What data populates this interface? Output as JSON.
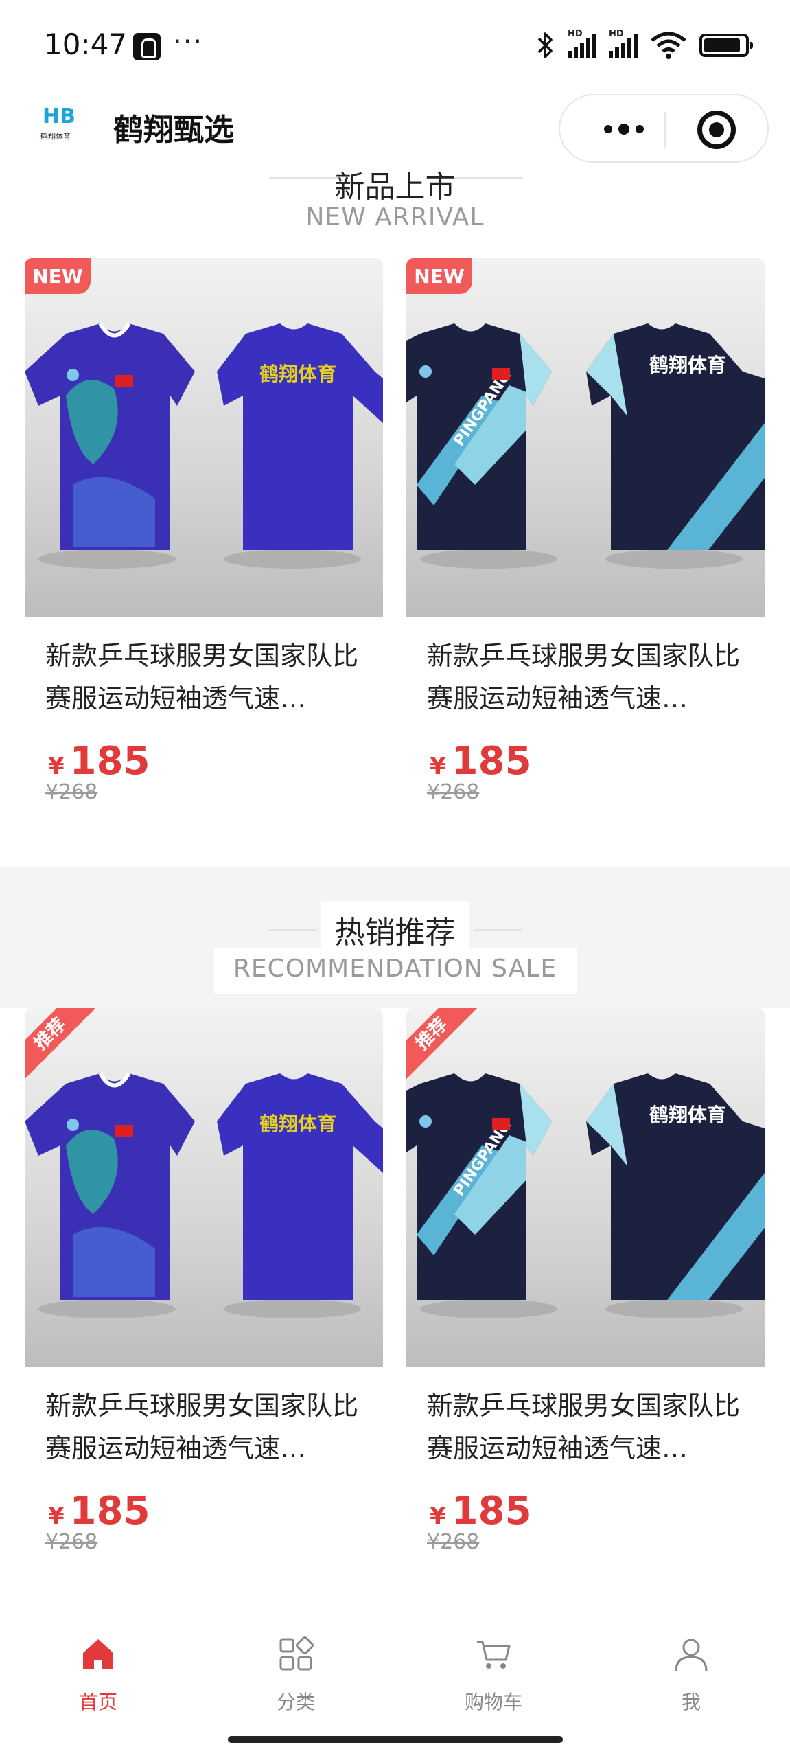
{
  "status_bar": {
    "time": "10:47",
    "dots": "···",
    "hd1": "HD",
    "hd2": "HD"
  },
  "navbar": {
    "logo_mark": "HB",
    "logo_text": "鹤翔体育",
    "title": "鹤翔甄选"
  },
  "sections": {
    "new": {
      "title_cn": "新品上市",
      "title_en": "NEW ARRIVAL",
      "badge": "NEW"
    },
    "rec": {
      "title_cn": "热销推荐",
      "title_en": "RECOMMENDATION SALE",
      "badge": "推荐"
    }
  },
  "products": [
    {
      "title": "新款乒乓球服男女国家队比赛服运动短袖透气速…",
      "price_symbol": "¥",
      "price": "185",
      "old_price": "¥268",
      "back_text": "鹤翔体育"
    },
    {
      "title": "新款乒乓球服男女国家队比赛服运动短袖透气速…",
      "price_symbol": "¥",
      "price": "185",
      "old_price": "¥268",
      "back_text": "鹤翔体育",
      "front_text": "PINGPANG"
    },
    {
      "title": "新款乒乓球服男女国家队比赛服运动短袖透气速…",
      "price_symbol": "¥",
      "price": "185",
      "old_price": "¥268",
      "back_text": "鹤翔体育"
    },
    {
      "title": "新款乒乓球服男女国家队比赛服运动短袖透气速…",
      "price_symbol": "¥",
      "price": "185",
      "old_price": "¥268",
      "back_text": "鹤翔体育",
      "front_text": "PINGPANG"
    }
  ],
  "tabbar": {
    "items": [
      {
        "label": "首页",
        "icon": "home-icon",
        "active": true
      },
      {
        "label": "分类",
        "icon": "category-icon",
        "active": false
      },
      {
        "label": "购物车",
        "icon": "cart-icon",
        "active": false
      },
      {
        "label": "我",
        "icon": "user-icon",
        "active": false
      }
    ]
  },
  "colors": {
    "accent": "#e03a3a",
    "badge": "#f25a5a",
    "jersey_blue": "#3b2fb5",
    "jersey_navy": "#1c2140",
    "jersey_cyan": "#8fd3e6"
  }
}
